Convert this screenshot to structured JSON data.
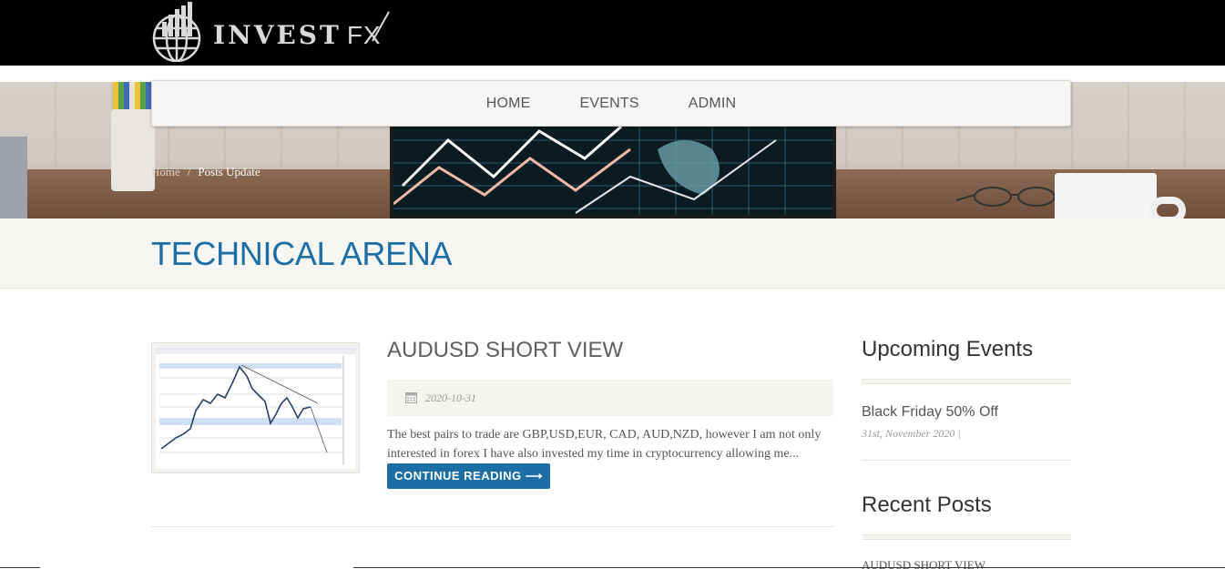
{
  "brand": {
    "name_part1": "INVEST",
    "name_part2": "FX"
  },
  "nav": {
    "items": [
      "HOME",
      "EVENTS",
      "ADMIN"
    ]
  },
  "breadcrumb": {
    "home": "Home",
    "separator": "/",
    "current": "Posts Update"
  },
  "page": {
    "title": "TECHNICAL ARENA"
  },
  "post": {
    "title": "AUDUSD SHORT VIEW",
    "date": "2020-10-31",
    "excerpt": "The best pairs to trade are GBP,USD,EUR, CAD, AUD,NZD, however I am  not only interested in forex I have also invested my time in cryptocurrency  allowing me...",
    "read_more": "CONTINUE READING ⟶",
    "thumbnail_icon": "chart-thumbnail-icon"
  },
  "sidebar": {
    "upcoming_title": "Upcoming Events",
    "event": {
      "title": "Black Friday 50% Off",
      "date": "31st, November 2020 |"
    },
    "recent_title": "Recent Posts",
    "recent_items": [
      "AUDUSD SHORT VIEW"
    ]
  },
  "colors": {
    "accent": "#1c6ea4",
    "topbar": "#000000",
    "band": "#f7f6f3"
  }
}
